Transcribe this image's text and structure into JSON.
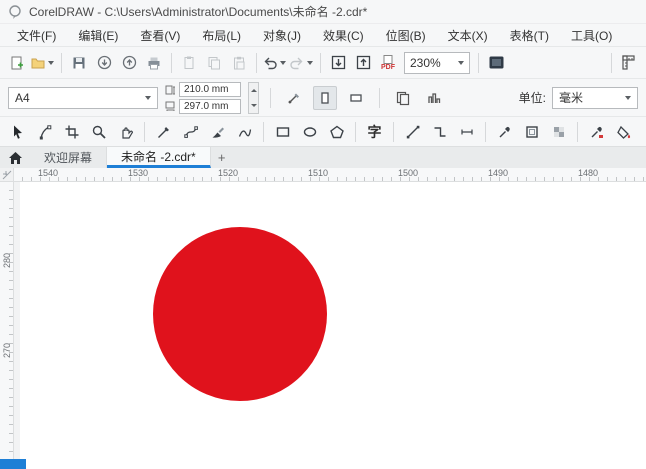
{
  "window": {
    "title": "CorelDRAW - C:\\Users\\Administrator\\Documents\\未命名 -2.cdr*"
  },
  "menu": {
    "items": [
      "文件(F)",
      "编辑(E)",
      "查看(V)",
      "布局(L)",
      "对象(J)",
      "效果(C)",
      "位图(B)",
      "文本(X)",
      "表格(T)",
      "工具(O)"
    ]
  },
  "toolbar": {
    "zoom_value": "230%",
    "pdf_label": "PDF"
  },
  "property_bar": {
    "page_size": "A4",
    "width_value": "210.0 mm",
    "height_value": "297.0 mm",
    "units_label": "单位:",
    "units_value": "毫米"
  },
  "toolbox": {
    "text_tool_glyph": "字"
  },
  "tabs": {
    "items": [
      "欢迎屏幕",
      "未命名 -2.cdr*"
    ],
    "add_label": "+"
  },
  "ruler": {
    "h_labels": [
      "1540",
      "1530",
      "1520",
      "1510",
      "1500",
      "1490",
      "1480"
    ],
    "v_labels": [
      "280",
      "270"
    ]
  },
  "canvas": {
    "circle_color": "#e0121c"
  },
  "colors": {
    "accent_blue": "#1e7fd6"
  }
}
